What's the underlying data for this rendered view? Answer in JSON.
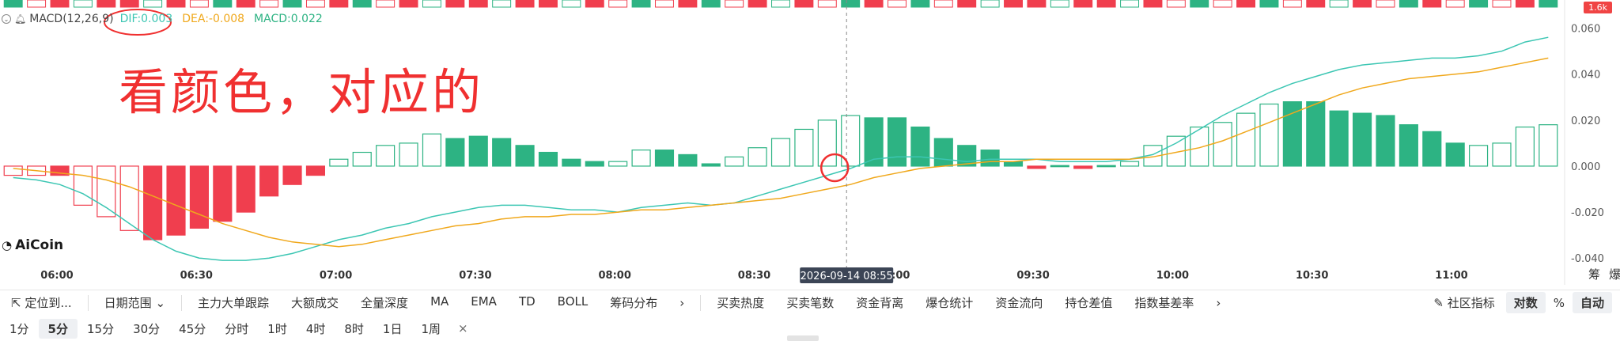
{
  "legend": {
    "indicator": "MACD(12,26,9)",
    "dif": "DIF:0.003",
    "dea": "DEA:-0.008",
    "macd": "MACD:0.022"
  },
  "annotation": "看颜色，对应的",
  "logo": "AiCoin",
  "top_chip": "1.6k",
  "crosshair_label": "2026-09-14 08:55",
  "toolbar": {
    "locate": "定位到...",
    "date_range": "日期范围",
    "items_left": [
      "主力大单跟踪",
      "大额成交",
      "全量深度",
      "MA",
      "EMA",
      "TD",
      "BOLL",
      "筹码分布"
    ],
    "items_right": [
      "买卖热度",
      "买卖笔数",
      "资金背离",
      "爆仓统计",
      "资金流向",
      "持仓差值",
      "指数基差率"
    ],
    "community": "社区指标",
    "log": "对数",
    "percent": "%",
    "auto": "自动"
  },
  "periods": [
    "1分",
    "5分",
    "15分",
    "30分",
    "45分",
    "分时",
    "1时",
    "4时",
    "8时",
    "1日",
    "1周"
  ],
  "period_active": "5分",
  "colors": {
    "up": "#2db383",
    "down": "#f03e4e",
    "dif": "#3cc6b3",
    "dea": "#f0a81c",
    "annotation": "#f03030"
  },
  "chart_data": {
    "type": "bar",
    "x_ticks": [
      "06:00",
      "06:30",
      "07:00",
      "07:30",
      "08:00",
      "08:30",
      "09:00",
      "09:30",
      "10:00",
      "10:30",
      "11:00"
    ],
    "y_ticks": [
      "0.060",
      "0.040",
      "0.020",
      "0.000",
      "-0.020",
      "-0.040"
    ],
    "right_labels": [
      "筹",
      "爆"
    ],
    "ylim": [
      -0.042,
      0.064
    ],
    "bars": {
      "values": [
        -0.004,
        -0.004,
        -0.004,
        -0.017,
        -0.022,
        -0.028,
        -0.032,
        -0.03,
        -0.027,
        -0.024,
        -0.02,
        -0.013,
        -0.008,
        -0.004,
        0.003,
        0.006,
        0.009,
        0.01,
        0.014,
        0.012,
        0.013,
        0.012,
        0.009,
        0.006,
        0.003,
        0.002,
        0.002,
        0.007,
        0.007,
        0.005,
        0.001,
        0.004,
        0.008,
        0.012,
        0.016,
        0.02,
        0.022,
        0.021,
        0.021,
        0.017,
        0.012,
        0.009,
        0.007,
        0.002,
        -0.001,
        0.0,
        -0.001,
        0.0,
        0.002,
        0.009,
        0.013,
        0.017,
        0.019,
        0.023,
        0.027,
        0.028,
        0.028,
        0.024,
        0.023,
        0.022,
        0.018,
        0.015,
        0.01,
        0.009,
        0.01,
        0.017,
        0.018
      ],
      "hollow": [
        true,
        true,
        false,
        true,
        true,
        true,
        false,
        false,
        false,
        false,
        false,
        false,
        false,
        false,
        true,
        true,
        true,
        true,
        true,
        false,
        false,
        false,
        false,
        false,
        false,
        false,
        true,
        true,
        false,
        false,
        false,
        true,
        true,
        true,
        true,
        true,
        true,
        false,
        false,
        false,
        false,
        false,
        false,
        false,
        false,
        false,
        false,
        false,
        true,
        true,
        true,
        true,
        true,
        true,
        true,
        false,
        false,
        false,
        false,
        false,
        false,
        false,
        false,
        true,
        true,
        true,
        true
      ]
    },
    "series": [
      {
        "values": [
          -0.005,
          -0.006,
          -0.008,
          -0.012,
          -0.018,
          -0.025,
          -0.032,
          -0.037,
          -0.04,
          -0.041,
          -0.041,
          -0.04,
          -0.038,
          -0.035,
          -0.032,
          -0.03,
          -0.027,
          -0.025,
          -0.022,
          -0.02,
          -0.018,
          -0.017,
          -0.017,
          -0.018,
          -0.019,
          -0.019,
          -0.02,
          -0.018,
          -0.017,
          -0.016,
          -0.017,
          -0.016,
          -0.013,
          -0.01,
          -0.007,
          -0.004,
          -0.001,
          0.003,
          0.004,
          0.004,
          0.003,
          0.002,
          0.003,
          0.003,
          0.003,
          0.002,
          0.002,
          0.002,
          0.003,
          0.005,
          0.01,
          0.016,
          0.022,
          0.027,
          0.032,
          0.036,
          0.039,
          0.042,
          0.044,
          0.045,
          0.046,
          0.047,
          0.047,
          0.048,
          0.05,
          0.054,
          0.056
        ]
      },
      {
        "values": [
          -0.001,
          -0.002,
          -0.003,
          -0.004,
          -0.006,
          -0.009,
          -0.013,
          -0.017,
          -0.021,
          -0.025,
          -0.028,
          -0.031,
          -0.033,
          -0.034,
          -0.035,
          -0.034,
          -0.032,
          -0.03,
          -0.028,
          -0.026,
          -0.025,
          -0.023,
          -0.022,
          -0.022,
          -0.021,
          -0.021,
          -0.02,
          -0.019,
          -0.019,
          -0.018,
          -0.017,
          -0.016,
          -0.015,
          -0.014,
          -0.012,
          -0.01,
          -0.008,
          -0.005,
          -0.003,
          -0.001,
          0.0,
          0.001,
          0.002,
          0.002,
          0.003,
          0.003,
          0.003,
          0.003,
          0.003,
          0.004,
          0.006,
          0.008,
          0.011,
          0.015,
          0.019,
          0.023,
          0.027,
          0.031,
          0.034,
          0.036,
          0.038,
          0.039,
          0.04,
          0.041,
          0.043,
          0.045,
          0.047
        ]
      }
    ],
    "top_strip": {
      "hollow": [
        false,
        true,
        false,
        true,
        false,
        false,
        true,
        false,
        true,
        false,
        false,
        true,
        false,
        true,
        false,
        false,
        true,
        false,
        true,
        false,
        false,
        true,
        false,
        false,
        true,
        false,
        true,
        false,
        true,
        false,
        false,
        true,
        false,
        true,
        false,
        true,
        false,
        false,
        true,
        false,
        true,
        false,
        true,
        false,
        false,
        true,
        false,
        false,
        true,
        false,
        true,
        false,
        true,
        false,
        false,
        true,
        false,
        true,
        false,
        true,
        false,
        false,
        true,
        false,
        true,
        false,
        false
      ]
    },
    "grid": false
  }
}
